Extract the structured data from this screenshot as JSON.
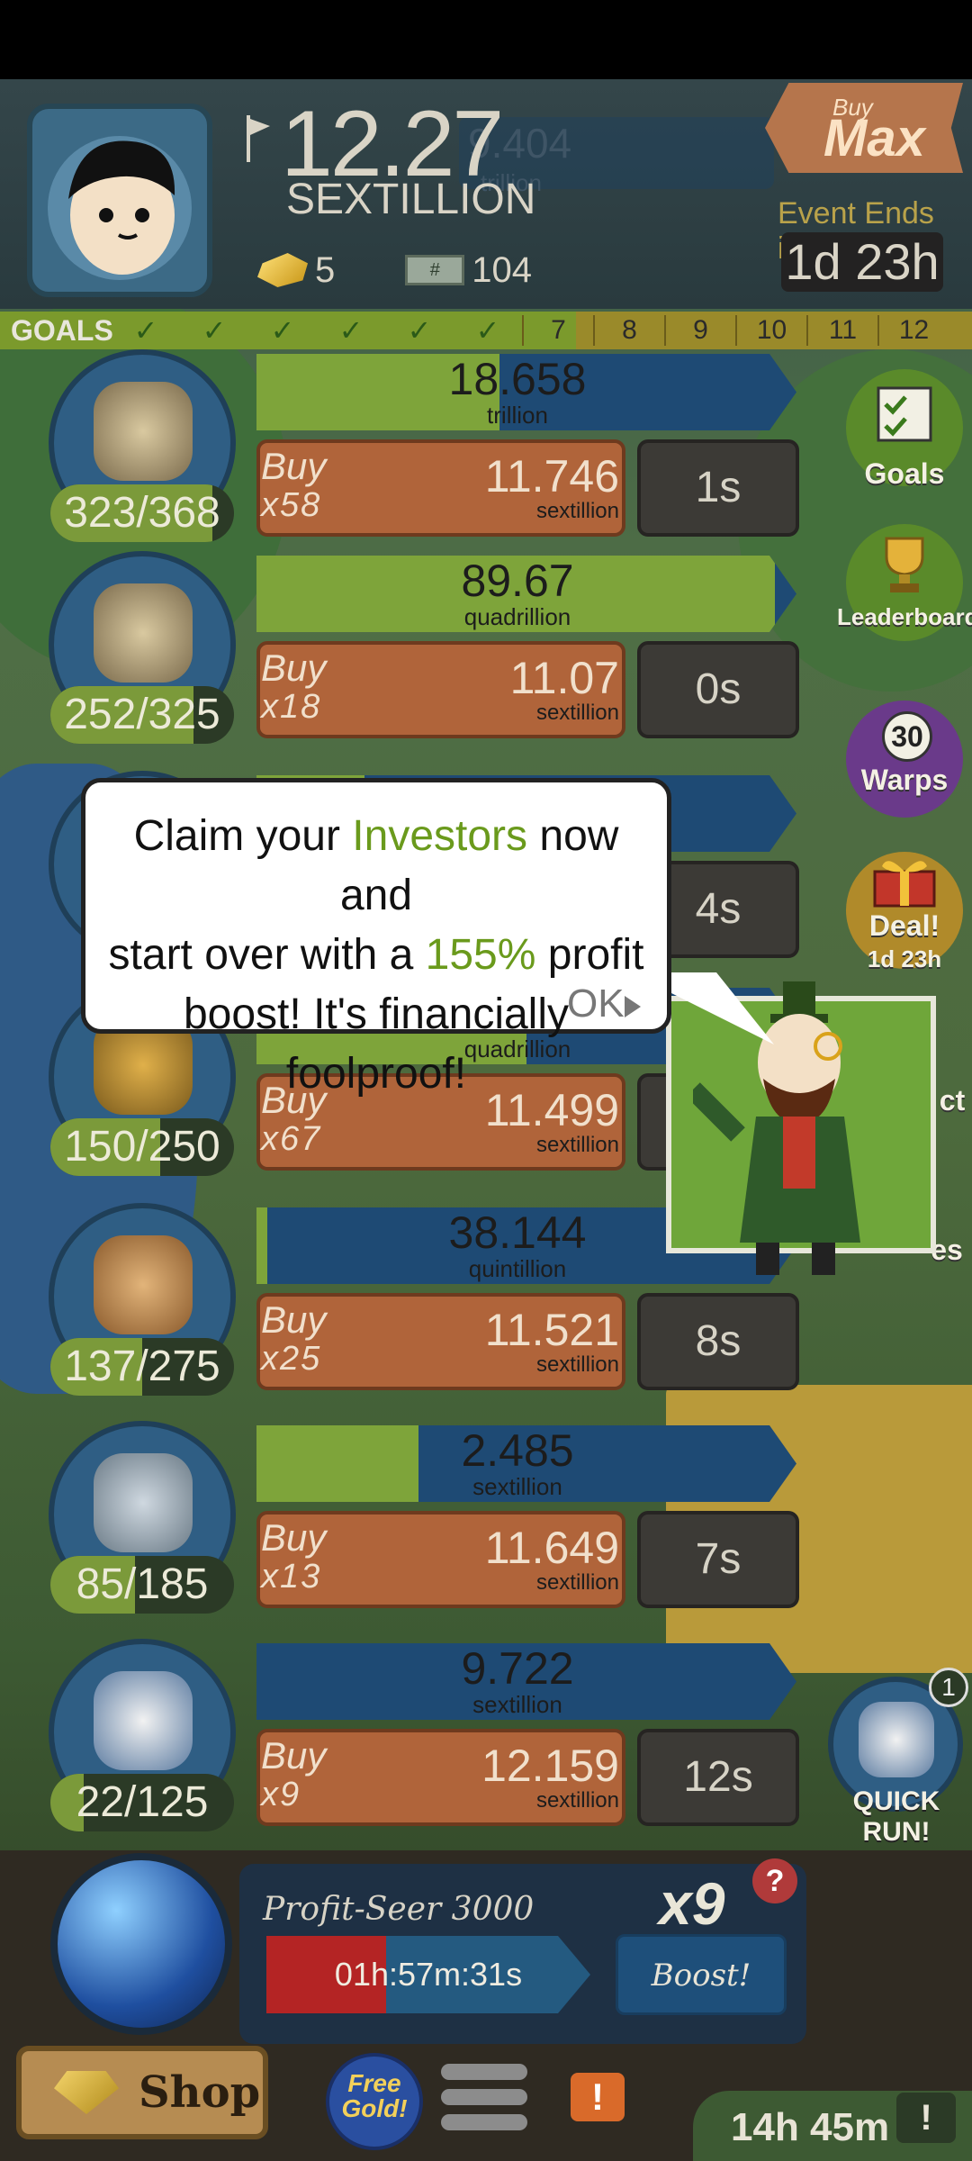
{
  "header": {
    "money_value": "12.27",
    "money_unit": "SEXTILLION",
    "behind_value": "9.404",
    "behind_unit": "trillion",
    "gold_count": "5",
    "megabucks_count": "104",
    "megabucks_symbol": "#",
    "buymax_top": "Buy",
    "buymax_main": "Max",
    "event_label": "Event Ends in:",
    "event_time": "1d 23h"
  },
  "goals": {
    "label": "GOALS",
    "checks": [
      "✓",
      "✓",
      "✓",
      "✓",
      "✓",
      "✓"
    ],
    "numbers": [
      "7",
      "8",
      "9",
      "10",
      "11",
      "12"
    ]
  },
  "rows": [
    {
      "count": "323/368",
      "count_fill": 0.88,
      "prog_value": "18.658",
      "prog_unit": "trillion",
      "prog_fill": 0.45,
      "buy_word": "Buy",
      "buy_mult": "x58",
      "buy_value": "11.746",
      "buy_unit": "sextillion",
      "timer": "1s"
    },
    {
      "count": "252/325",
      "count_fill": 0.78,
      "prog_value": "89.67",
      "prog_unit": "quadrillion",
      "prog_fill": 0.96,
      "buy_word": "Buy",
      "buy_mult": "x18",
      "buy_value": "11.07",
      "buy_unit": "sextillion",
      "timer": "0s"
    },
    {
      "count": "",
      "count_fill": 0.5,
      "prog_value": "",
      "prog_unit": "",
      "prog_fill": 0.2,
      "buy_word": "",
      "buy_mult": "",
      "buy_value": "",
      "buy_unit": "",
      "timer": "4s"
    },
    {
      "count": "150/250",
      "count_fill": 0.6,
      "prog_value": "",
      "prog_unit": "quadrillion",
      "prog_fill": 0.5,
      "buy_word": "Buy",
      "buy_mult": "x67",
      "buy_value": "11.499",
      "buy_unit": "sextillion",
      "timer": ""
    },
    {
      "count": "137/275",
      "count_fill": 0.5,
      "prog_value": "38.144",
      "prog_unit": "quintillion",
      "prog_fill": 0.02,
      "buy_word": "Buy",
      "buy_mult": "x25",
      "buy_value": "11.521",
      "buy_unit": "sextillion",
      "timer": "8s"
    },
    {
      "count": "85/185",
      "count_fill": 0.46,
      "prog_value": "2.485",
      "prog_unit": "sextillion",
      "prog_fill": 0.3,
      "buy_word": "Buy",
      "buy_mult": "x13",
      "buy_value": "11.649",
      "buy_unit": "sextillion",
      "timer": "7s"
    },
    {
      "count": "22/125",
      "count_fill": 0.18,
      "prog_value": "9.722",
      "prog_unit": "sextillion",
      "prog_fill": 0.0,
      "buy_word": "Buy",
      "buy_mult": "x9",
      "buy_value": "12.159",
      "buy_unit": "sextillion",
      "timer": "12s"
    }
  ],
  "side": {
    "goals": "Goals",
    "leaderboard": "Leaderboard",
    "warps_count": "30",
    "warps": "Warps",
    "deal": "Deal!",
    "deal_time": "1d 23h",
    "partial1": "ct",
    "partial2": "es"
  },
  "dialog": {
    "line1_a": "Claim your ",
    "line1_hl": "Investors",
    "line1_b": " now and",
    "line2_a": "start over with a ",
    "line2_hl": "155%",
    "line2_b": " profit",
    "line3": "boost! It's financially foolproof!",
    "ok": "OK"
  },
  "quickrun": {
    "badge": "1",
    "label": "QUICK RUN!"
  },
  "manager": {
    "name": "Profit-Seer 3000",
    "multiplier": "x9",
    "help": "?",
    "timer": "01h:57m:31s",
    "timer_fill": 0.37,
    "boost": "Boost!"
  },
  "bottom": {
    "shop": "Shop",
    "free_gold": "Free Gold!",
    "alert": "!",
    "offline_time": "14h 45m",
    "offline_btn": "!"
  },
  "colors": {
    "green_text": "#6a9a1c",
    "buy_orange": "#b0643a",
    "progress_blue": "#1e4a74",
    "progress_green": "#7ea43a"
  }
}
